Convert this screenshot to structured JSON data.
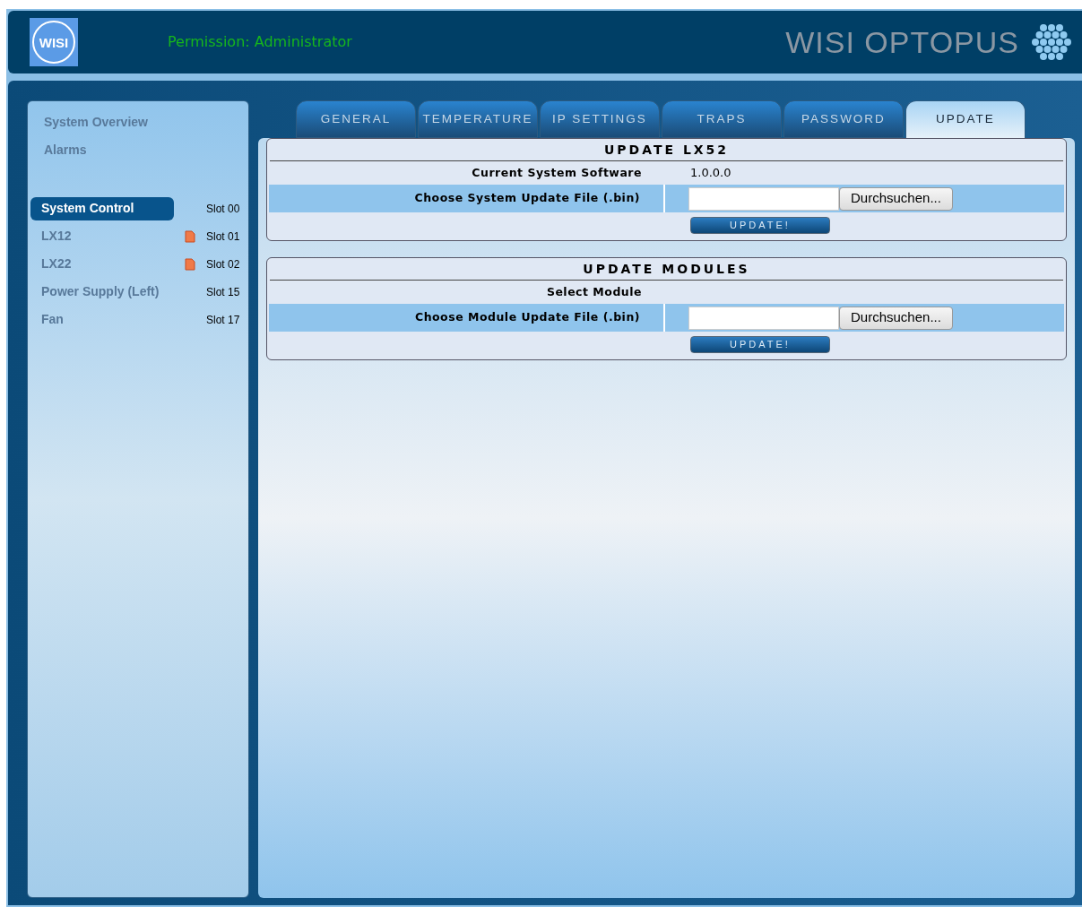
{
  "header": {
    "logo_text": "WISI",
    "permission": "Permission: Administrator",
    "brand": "WISI OPTOPUS"
  },
  "sidebar": {
    "links": [
      "System Overview",
      "Alarms"
    ],
    "modules": [
      {
        "name": "System Control",
        "slot": "Slot 00",
        "selected": true,
        "alarm": false
      },
      {
        "name": "LX12",
        "slot": "Slot 01",
        "selected": false,
        "alarm": true
      },
      {
        "name": "LX22",
        "slot": "Slot 02",
        "selected": false,
        "alarm": true
      },
      {
        "name": "Power Supply (Left)",
        "slot": "Slot 15",
        "selected": false,
        "alarm": false
      },
      {
        "name": "Fan",
        "slot": "Slot 17",
        "selected": false,
        "alarm": false
      }
    ]
  },
  "tabs": [
    {
      "label": "GENERAL",
      "selected": false
    },
    {
      "label": "TEMPERATURE",
      "selected": false
    },
    {
      "label": "IP SETTINGS",
      "selected": false
    },
    {
      "label": "TRAPS",
      "selected": false
    },
    {
      "label": "PASSWORD",
      "selected": false
    },
    {
      "label": "UPDATE",
      "selected": true
    }
  ],
  "sections": [
    {
      "title": "UPDATE LX52",
      "rows": [
        {
          "kind": "info",
          "label": "Current System Software",
          "value": "1.0.0.0"
        },
        {
          "kind": "file",
          "label": "Choose System Update File (.bin)",
          "browse": "Durchsuchen..."
        },
        {
          "kind": "action",
          "button": "UPDATE!"
        }
      ]
    },
    {
      "title": "UPDATE MODULES",
      "rows": [
        {
          "kind": "info",
          "label": "Select Module"
        },
        {
          "kind": "file",
          "label": "Choose Module Update File (.bin)",
          "browse": "Durchsuchen..."
        },
        {
          "kind": "action",
          "button": "UPDATE!"
        }
      ]
    }
  ]
}
